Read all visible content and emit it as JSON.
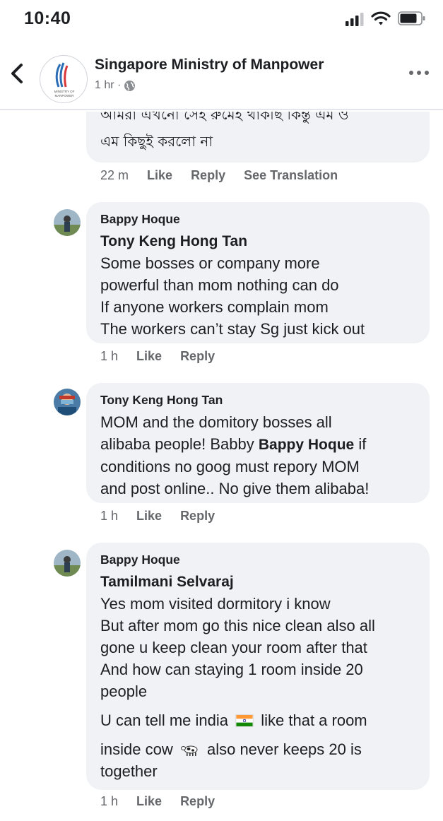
{
  "status_bar": {
    "time": "10:40"
  },
  "header": {
    "page_name": "Singapore Ministry of Manpower",
    "post_age": "1 hr ·",
    "avatar_text": "MINISTRY OF MANPOWER"
  },
  "comments": [
    {
      "lines": [
        "আমরা এখনো সেই রুমেই থাকছি কিন্তু এম ও",
        "এম কিছুই করলো না"
      ],
      "time": "22 m",
      "like": "Like",
      "reply": "Reply",
      "translate": "See Translation"
    },
    {
      "author": "Bappy Hoque",
      "mention": "Tony Keng Hong Tan",
      "lines": [
        "Some bosses or company more",
        "powerful than  mom nothing can do",
        "If anyone workers complain mom",
        "The workers can’t stay Sg just kick out"
      ],
      "time": "1 h",
      "like": "Like",
      "reply": "Reply"
    },
    {
      "author": "Tony Keng Hong Tan",
      "line1": "MOM and the domitory bosses all",
      "line2_pre": "alibaba people! Babby ",
      "line2_mention": "Bappy Hoque",
      "line2_post": " if",
      "line3": "conditions no goog must repory MOM",
      "line4": "and post online.. No give them alibaba!",
      "time": "1 h",
      "like": "Like",
      "reply": "Reply"
    },
    {
      "author": "Bappy Hoque",
      "mention": "Tamilmani Selvaraj",
      "lines": [
        "Yes mom visited dormitory i know",
        "But after mom go this nice clean also all",
        "gone u keep clean your room after that",
        "And how can staying 1 room inside 20",
        "people"
      ],
      "line6_pre": "U can tell me india",
      "line6_post": "like that a room",
      "line7_pre": "inside cow",
      "line7_post": "also never keeps 20 is",
      "line8": "together",
      "time": "1 h",
      "like": "Like",
      "reply": "Reply"
    }
  ],
  "colors": {
    "bubble": "#f0f2f5",
    "meta_text": "#65676b",
    "primary_text": "#1c1e21"
  }
}
